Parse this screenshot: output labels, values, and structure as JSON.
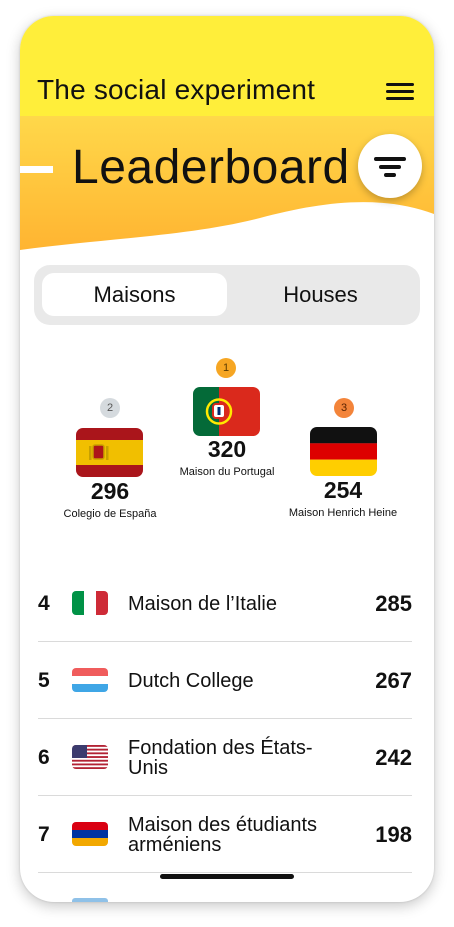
{
  "app": {
    "title": "The social experiment"
  },
  "banner": {
    "title": "Leaderboard"
  },
  "tabs": [
    {
      "label": "Maisons",
      "active": true
    },
    {
      "label": "Houses",
      "active": false
    }
  ],
  "podium": {
    "first": {
      "rank": "1",
      "score": "320",
      "name": "Maison du Portugal",
      "flag": "portugal-flag"
    },
    "second": {
      "rank": "2",
      "score": "296",
      "name": "Colegio de España",
      "flag": "spain-flag"
    },
    "third": {
      "rank": "3",
      "score": "254",
      "name": "Maison Henrich Heine",
      "flag": "germany-flag"
    }
  },
  "rankings": [
    {
      "rank": "4",
      "name": "Maison de l’Italie",
      "score": "285",
      "flag": "italy-flag"
    },
    {
      "rank": "5",
      "name": "Dutch College",
      "score": "267",
      "flag": "netherlands-flag"
    },
    {
      "rank": "6",
      "name": "Fondation des États-Unis",
      "score": "242",
      "flag": "usa-flag"
    },
    {
      "rank": "7",
      "name": "Maison des étudiants arméniens",
      "score": "198",
      "flag": "armenia-flag"
    }
  ],
  "colors": {
    "topbar": "#ffee3a",
    "banner_top": "#ffd84a",
    "banner_bottom": "#ffb431",
    "badge_gold": "#f6a623",
    "badge_silver": "#d5dade",
    "badge_bronze": "#f3843a"
  }
}
